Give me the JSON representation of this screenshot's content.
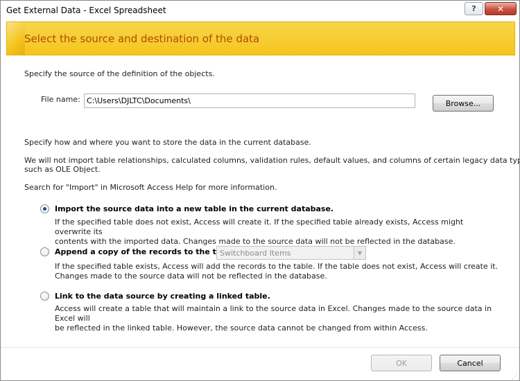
{
  "window": {
    "title": "Get External Data - Excel Spreadsheet",
    "help_label": "?",
    "close_label": "✕"
  },
  "banner": {
    "text": "Select the source and destination of the data"
  },
  "source": {
    "intro": "Specify the source of the definition of the objects.",
    "file_label": "File name:",
    "file_value": "C:\\Users\\DJLTC\\Documents\\",
    "browse_label": "Browse..."
  },
  "storage": {
    "intro": "Specify how and where you want to store the data in the current database.",
    "note_line1": "We will not import table relationships, calculated columns, validation rules, default values, and columns of certain legacy data types",
    "note_line2": "such as OLE Object.",
    "help_hint": "Search for \"Import\" in Microsoft Access Help for more information."
  },
  "options": [
    {
      "label": "Import the source data into a new table in the current database.",
      "desc_line1": "If the specified table does not exist, Access will create it. If the specified table already exists, Access might overwrite its",
      "desc_line2": "contents with the imported data. Changes made to the source data will not be reflected in the database.",
      "selected": true
    },
    {
      "label": "Append a copy of the records to the table:",
      "select_value": "Switchboard Items",
      "desc_line1": "If the specified table exists, Access will add the records to the table. If the table does not exist, Access will create it.",
      "desc_line2": "Changes made to the source data will not be reflected in the database.",
      "selected": false
    },
    {
      "label": "Link to the data source by creating a linked table.",
      "desc_line1": "Access will create a table that will maintain a link to the source data in Excel. Changes made to the source data in Excel will",
      "desc_line2": "be reflected in the linked table. However, the source data cannot be changed from within Access.",
      "selected": false
    }
  ],
  "footer": {
    "ok_label": "OK",
    "cancel_label": "Cancel"
  },
  "colors": {
    "banner": "#f5c51d",
    "banner_text": "#b34a00",
    "radio_selected": "#1f4c8f"
  }
}
